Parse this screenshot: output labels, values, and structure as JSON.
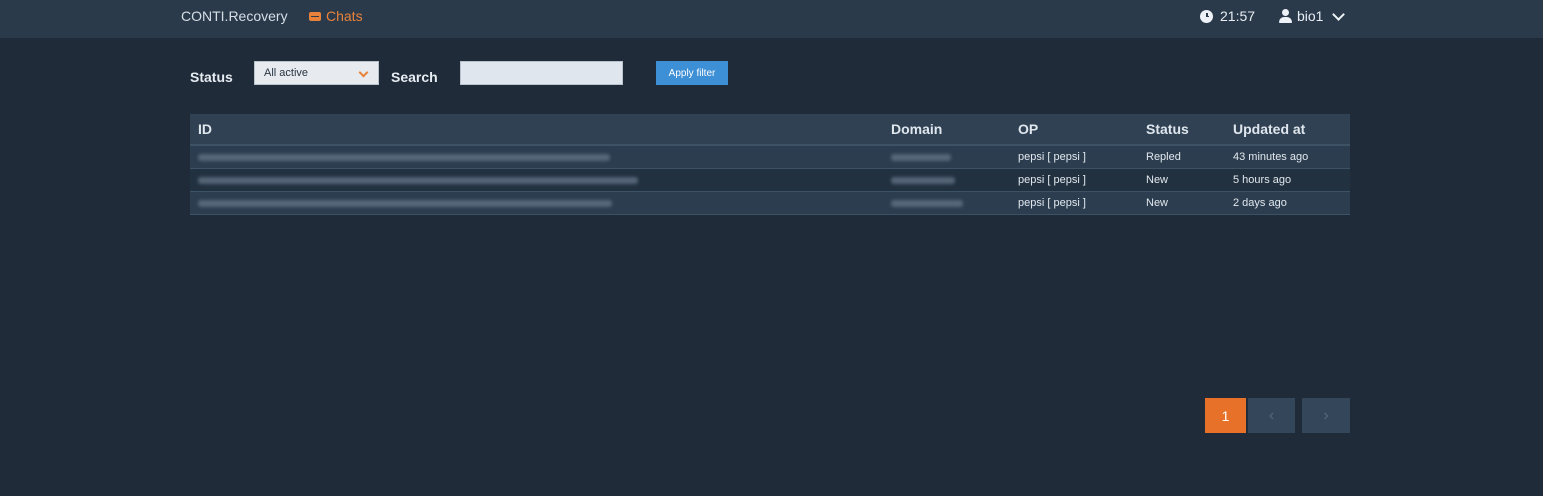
{
  "header": {
    "brand": "CONTI.Recovery",
    "nav_chats": "Chats",
    "time": "21:57",
    "username": "bio1"
  },
  "filters": {
    "status_label": "Status",
    "status_value": "All active",
    "search_label": "Search",
    "search_value": "",
    "apply_label": "Apply filter"
  },
  "table": {
    "columns": [
      "ID",
      "Domain",
      "OP",
      "Status",
      "Updated at"
    ],
    "rows": [
      {
        "op": "pepsi [ pepsi ]",
        "status": "Repled",
        "updated": "43 minutes ago"
      },
      {
        "op": "pepsi [ pepsi ]",
        "status": "New",
        "updated": "5 hours ago"
      },
      {
        "op": "pepsi [ pepsi ]",
        "status": "New",
        "updated": "2 days ago"
      }
    ]
  },
  "pagination": {
    "current": "1",
    "prev": "‹",
    "next": "›"
  },
  "colors": {
    "accent": "#e8712a",
    "primary": "#3d8fd6",
    "status_new": "#38b88f",
    "background": "#1f2b38"
  },
  "icons": [
    "chat-icon",
    "clock-icon",
    "user-icon",
    "chevron-down-icon"
  ]
}
